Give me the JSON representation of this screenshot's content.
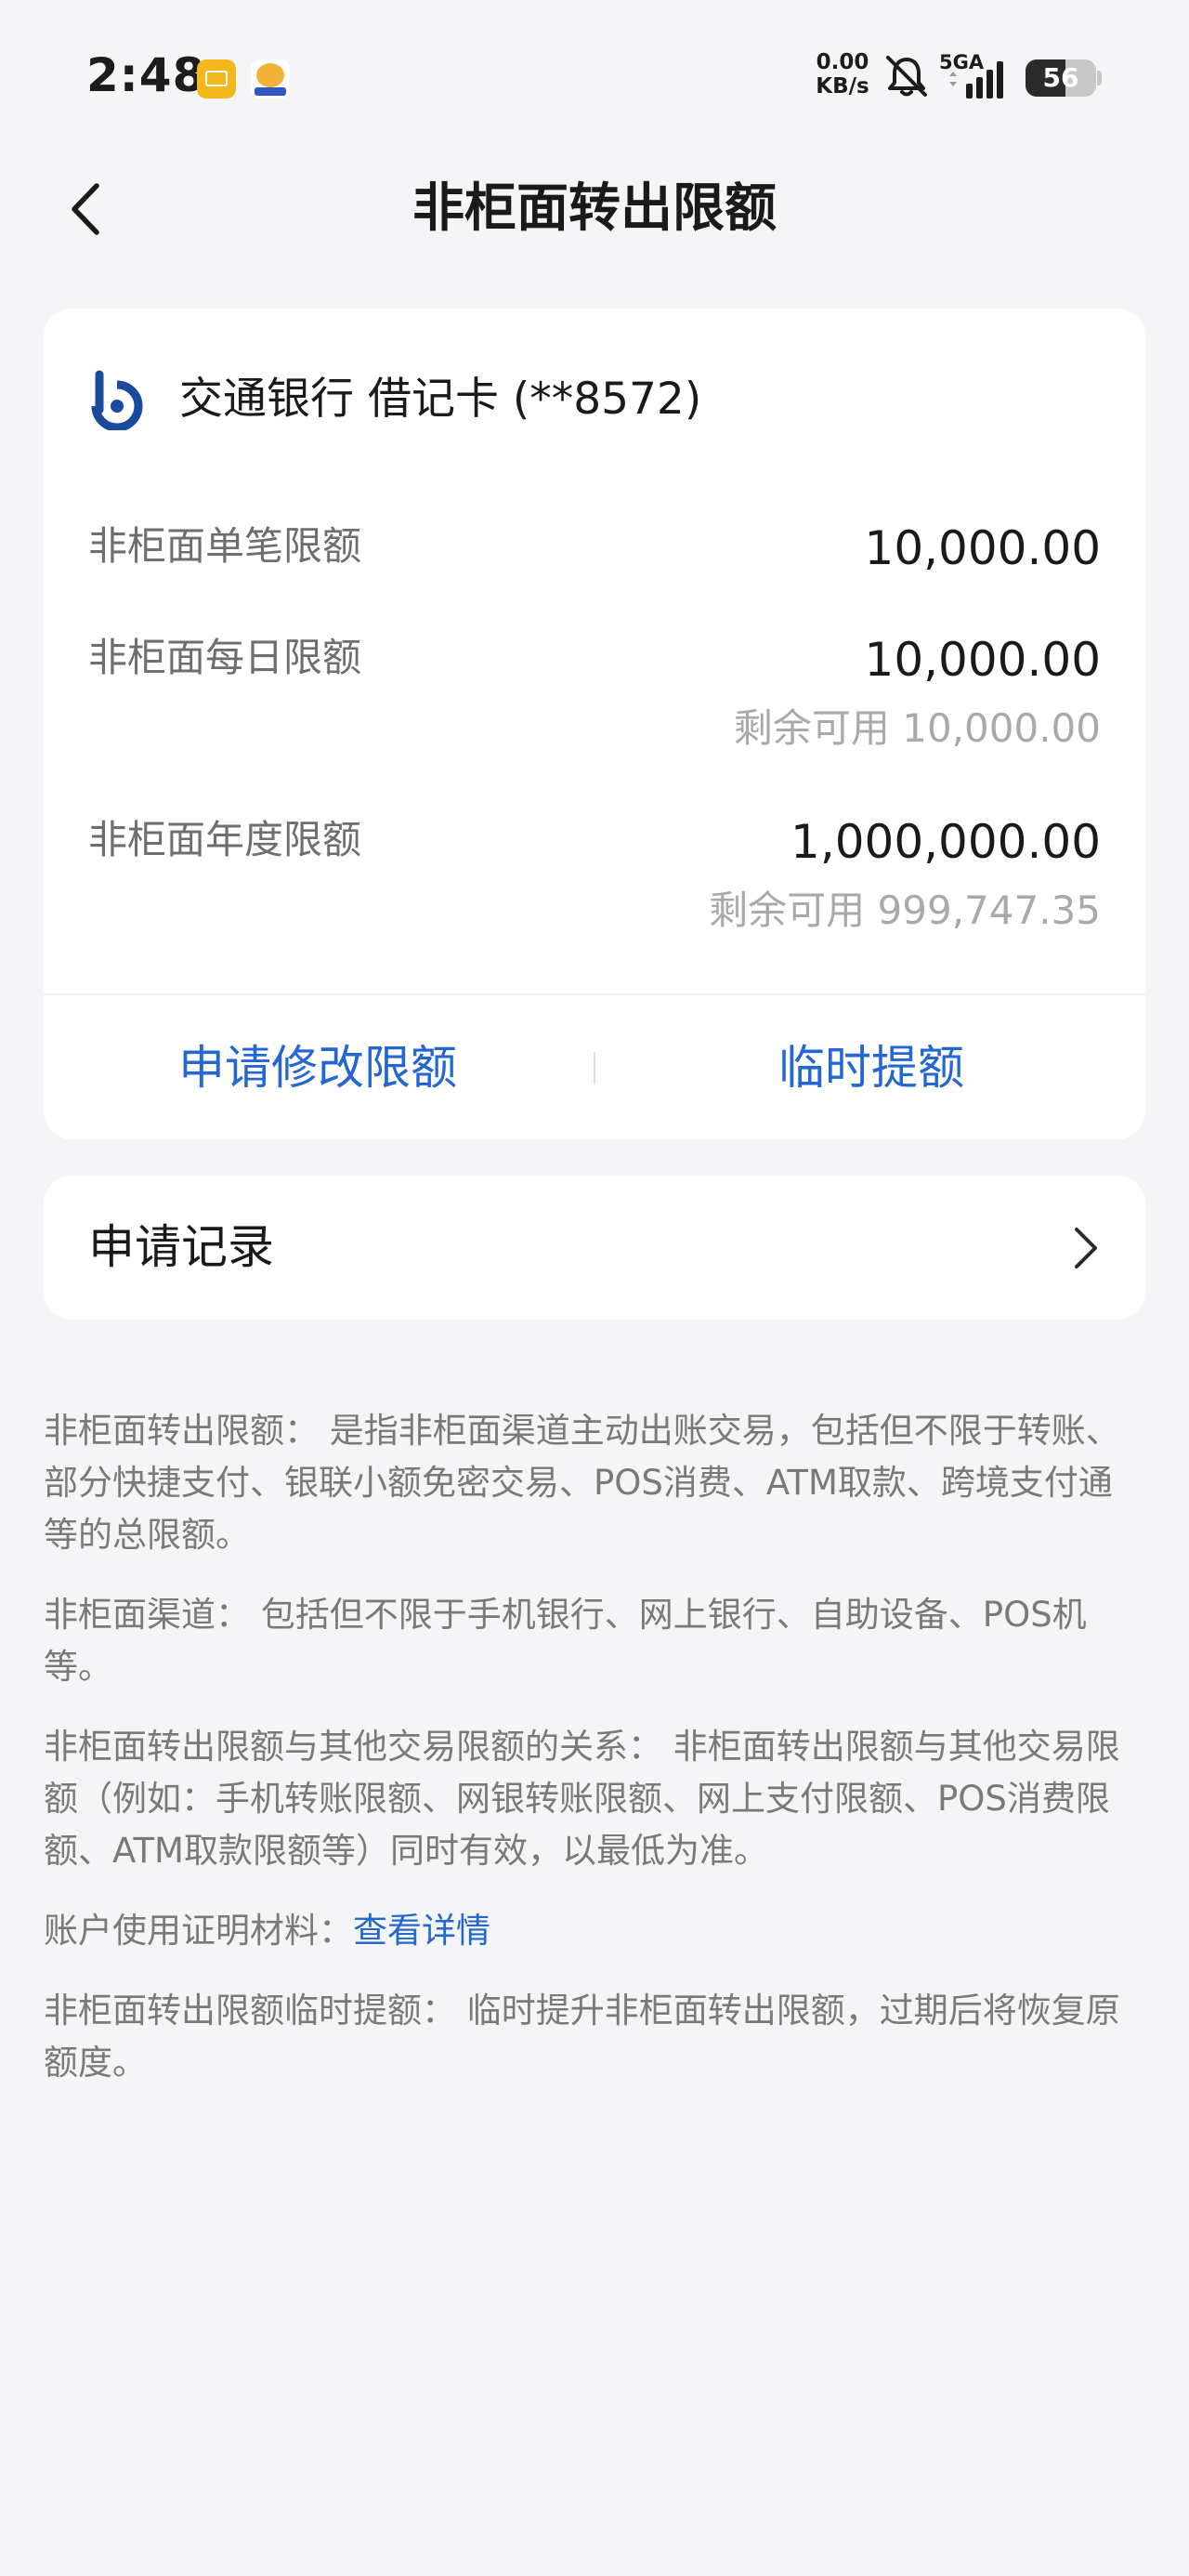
{
  "status_bar": {
    "time": "2:48",
    "net_speed_value": "0.00",
    "net_speed_unit": "KB/s",
    "network": "5GA",
    "battery": "56",
    "battery_level_percent": 56
  },
  "nav": {
    "title": "非柜面转出限额"
  },
  "card": {
    "bank_name": "交通银行 借记卡 (**8572)",
    "limits": [
      {
        "label": "非柜面单笔限额",
        "value": "10,000.00",
        "remaining": ""
      },
      {
        "label": "非柜面每日限额",
        "value": "10,000.00",
        "remaining": "剩余可用 10,000.00"
      },
      {
        "label": "非柜面年度限额",
        "value": "1,000,000.00",
        "remaining": "剩余可用 999,747.35"
      }
    ],
    "actions": {
      "modify": "申请修改限额",
      "temporary": "临时提额"
    }
  },
  "records": {
    "label": "申请记录"
  },
  "notes": [
    {
      "text": "非柜面转出限额： 是指非柜面渠道主动出账交易，包括但不限于转账、部分快捷支付、银联小额免密交易、POS消费、ATM取款、跨境支付通等的总限额。"
    },
    {
      "text": "非柜面渠道： 包括但不限于手机银行、网上银行、自助设备、POS机等。"
    },
    {
      "text": "非柜面转出限额与其他交易限额的关系： 非柜面转出限额与其他交易限额（例如：手机转账限额、网银转账限额、网上支付限额、POS消费限额、ATM取款限额等）同时有效，以最低为准。"
    },
    {
      "text": "账户使用证明材料：",
      "link": "查看详情"
    },
    {
      "text": "非柜面转出限额临时提额： 临时提升非柜面转出限额，过期后将恢复原额度。"
    }
  ],
  "colors": {
    "accent": "#2467d0",
    "background": "#f5f5f7",
    "card": "#ffffff",
    "muted_text": "#7a7a7a",
    "bank_logo": "#1b4a9c"
  }
}
